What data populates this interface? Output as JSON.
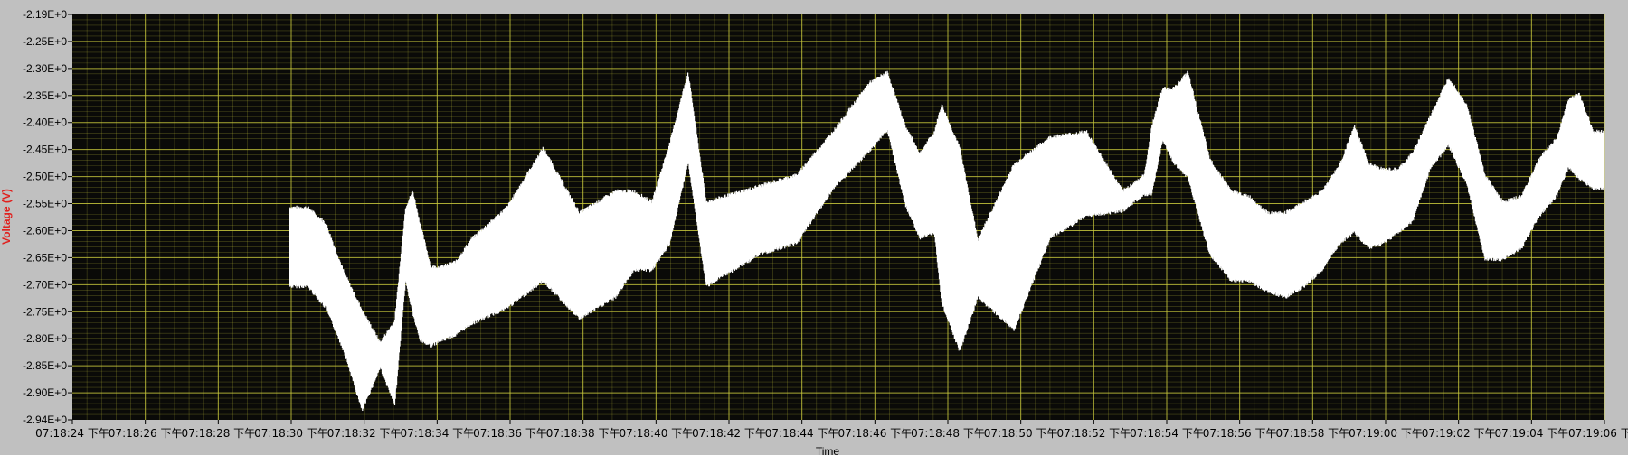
{
  "chart_data": {
    "type": "line",
    "title": "",
    "xlabel": "Time",
    "ylabel": "Voltage (V)",
    "ylabel_color": "#e0201e",
    "plot_background": "#0a0a08",
    "grid_color": "#c8c83c",
    "series_color": "#ffffff",
    "grid": true,
    "x_ticks": [
      "07:18:24 下午",
      "07:18:26 下午",
      "07:18:28 下午",
      "07:18:30 下午",
      "07:18:32 下午",
      "07:18:34 下午",
      "07:18:36 下午",
      "07:18:38 下午",
      "07:18:40 下午",
      "07:18:42 下午",
      "07:18:44 下午",
      "07:18:46 下午",
      "07:18:48 下午",
      "07:18:50 下午",
      "07:18:52 下午",
      "07:18:54 下午",
      "07:18:56 下午",
      "07:18:58 下午",
      "07:19:00 下午",
      "07:19:02 下午",
      "07:19:04 下午",
      "07:19:06 下"
    ],
    "y_ticks": [
      "-2.19E+0",
      "-2.25E+0",
      "-2.30E+0",
      "-2.35E+0",
      "-2.40E+0",
      "-2.45E+0",
      "-2.50E+0",
      "-2.55E+0",
      "-2.60E+0",
      "-2.65E+0",
      "-2.70E+0",
      "-2.75E+0",
      "-2.80E+0",
      "-2.85E+0",
      "-2.90E+0",
      "-2.94E+0"
    ],
    "ylim": [
      -2.94,
      -2.19
    ],
    "xlim": [
      0,
      42.3
    ],
    "x_unit_note": "seconds after 07:18:24",
    "series": [
      {
        "x": [
          6.0,
          6.5,
          7.0,
          7.5,
          8.0,
          8.5,
          8.9,
          9.2,
          9.4,
          9.6,
          9.9,
          10.2,
          10.6,
          11.0,
          12.0,
          13.0,
          14.0,
          15.0,
          15.5,
          16.0,
          16.5,
          17.0,
          17.5,
          18.0,
          19.0,
          20.0,
          21.0,
          22.0,
          22.5,
          23.0,
          23.4,
          23.8,
          24.0,
          24.5,
          25.0,
          26.0,
          27.0,
          28.0,
          29.0,
          29.4,
          29.6,
          29.8,
          30.1,
          30.4,
          30.8,
          31.4,
          32.0,
          32.5,
          33.0,
          33.5,
          34.0,
          34.5,
          35.0,
          35.4,
          35.8,
          36.2,
          36.6,
          37.0,
          37.5,
          38.0,
          38.5,
          39.0,
          39.5,
          40.0,
          40.5,
          41.0,
          41.3,
          41.6,
          42.0,
          42.3
        ],
        "upper": [
          -2.55,
          -2.55,
          -2.58,
          -2.67,
          -2.74,
          -2.8,
          -2.76,
          -2.55,
          -2.52,
          -2.58,
          -2.66,
          -2.66,
          -2.65,
          -2.61,
          -2.55,
          -2.44,
          -2.56,
          -2.52,
          -2.52,
          -2.54,
          -2.43,
          -2.3,
          -2.54,
          -2.53,
          -2.51,
          -2.49,
          -2.41,
          -2.32,
          -2.3,
          -2.4,
          -2.45,
          -2.41,
          -2.36,
          -2.44,
          -2.61,
          -2.47,
          -2.42,
          -2.41,
          -2.52,
          -2.5,
          -2.49,
          -2.4,
          -2.33,
          -2.33,
          -2.3,
          -2.46,
          -2.52,
          -2.53,
          -2.56,
          -2.56,
          -2.54,
          -2.52,
          -2.47,
          -2.4,
          -2.47,
          -2.48,
          -2.48,
          -2.45,
          -2.38,
          -2.31,
          -2.36,
          -2.49,
          -2.54,
          -2.53,
          -2.46,
          -2.42,
          -2.35,
          -2.34,
          -2.41,
          -2.41
        ],
        "lower": [
          -2.69,
          -2.69,
          -2.73,
          -2.81,
          -2.92,
          -2.84,
          -2.91,
          -2.68,
          -2.74,
          -2.79,
          -2.8,
          -2.79,
          -2.78,
          -2.76,
          -2.73,
          -2.68,
          -2.75,
          -2.71,
          -2.66,
          -2.66,
          -2.61,
          -2.46,
          -2.69,
          -2.67,
          -2.63,
          -2.61,
          -2.51,
          -2.44,
          -2.4,
          -2.54,
          -2.6,
          -2.59,
          -2.72,
          -2.81,
          -2.71,
          -2.77,
          -2.6,
          -2.56,
          -2.55,
          -2.53,
          -2.52,
          -2.52,
          -2.42,
          -2.46,
          -2.49,
          -2.63,
          -2.68,
          -2.68,
          -2.7,
          -2.71,
          -2.69,
          -2.66,
          -2.61,
          -2.59,
          -2.62,
          -2.61,
          -2.59,
          -2.57,
          -2.47,
          -2.43,
          -2.5,
          -2.64,
          -2.64,
          -2.62,
          -2.56,
          -2.52,
          -2.47,
          -2.49,
          -2.51,
          -2.51
        ]
      }
    ]
  }
}
